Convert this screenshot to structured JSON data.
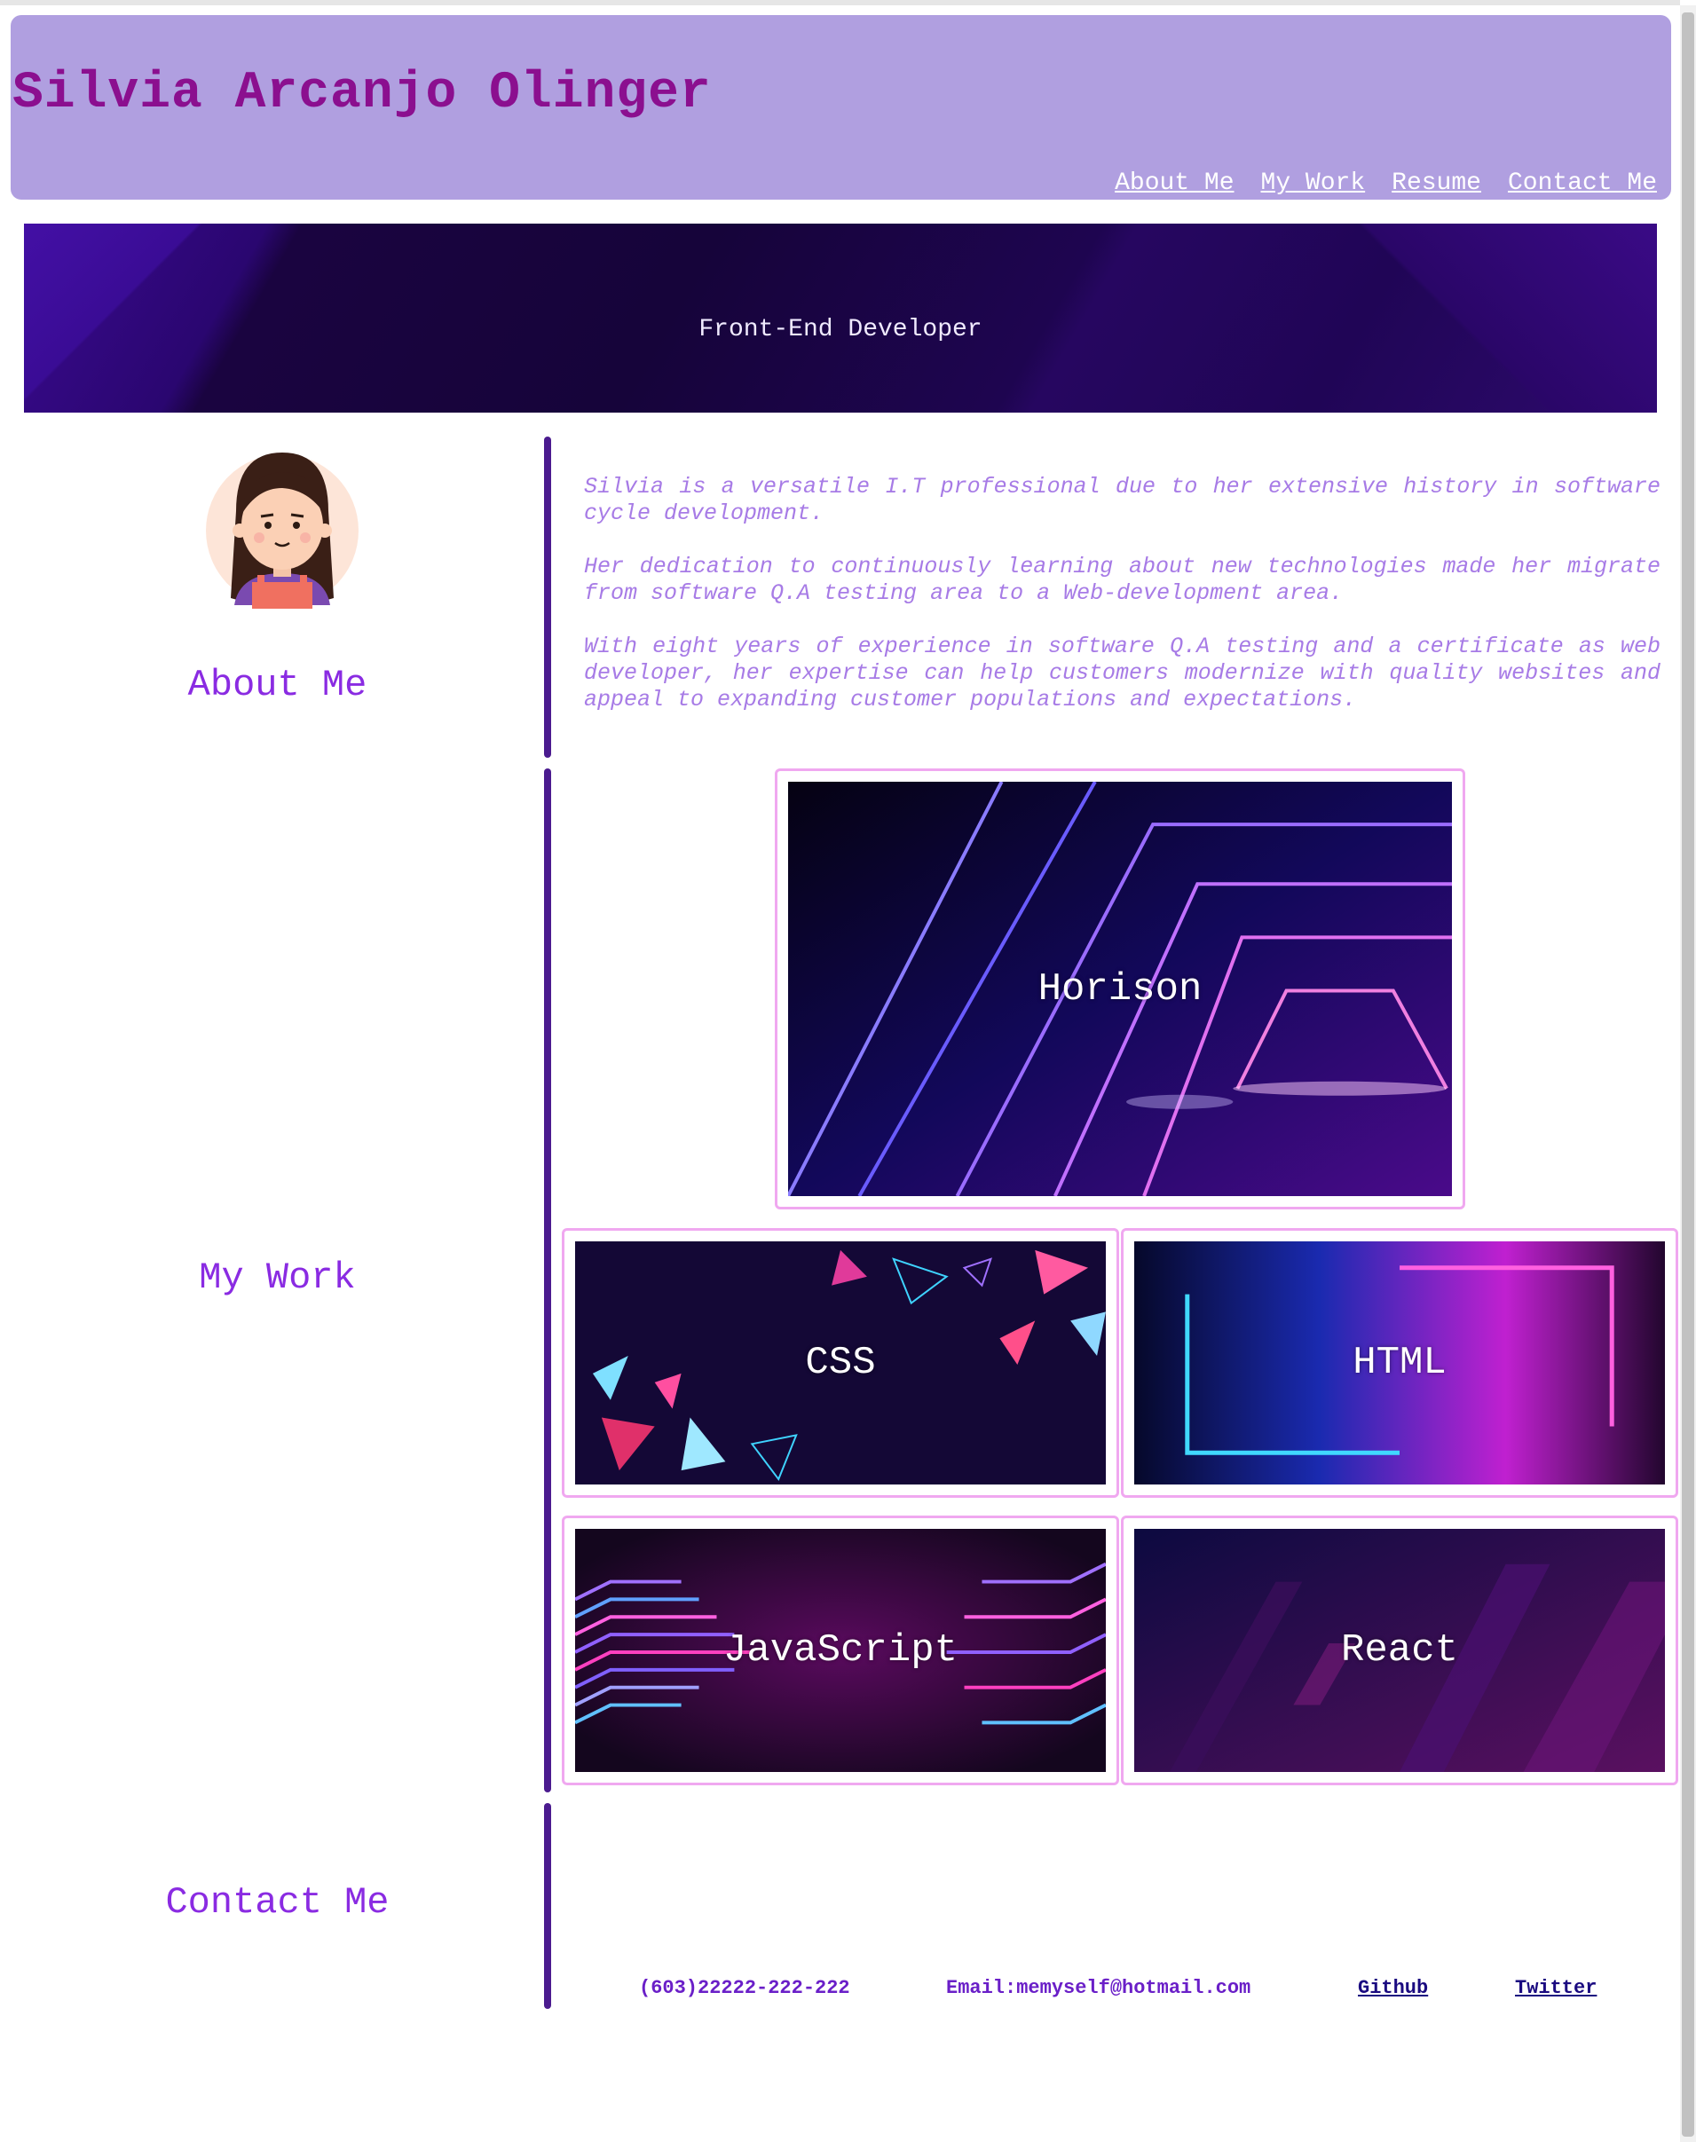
{
  "header": {
    "title": "Silvia Arcanjo Olinger",
    "nav": [
      "About Me",
      "My Work",
      "Resume",
      "Contact Me"
    ]
  },
  "hero": {
    "subtitle": "Front-End Developer"
  },
  "sections": {
    "about": "About Me",
    "work": "My Work",
    "contact": "Contact Me"
  },
  "about": {
    "paragraphs": [
      "Silvia is a versatile I.T professional due to her extensive history in software cycle development.",
      "Her dedication to continuously learning about new technologies made her migrate from software Q.A testing area to a Web-development area.",
      "With eight years of experience in software Q.A testing and a certificate as web developer, her expertise can help customers modernize with quality websites and appeal to expanding customer populations and expectations."
    ]
  },
  "projects": [
    {
      "title": "Horison"
    },
    {
      "title": "CSS"
    },
    {
      "title": "HTML"
    },
    {
      "title": "JavaScript"
    },
    {
      "title": "React"
    }
  ],
  "contact": {
    "phone": "(603)22222-222-222",
    "email": "Email:memyself@hotmail.com",
    "github": "Github",
    "twitter": "Twitter"
  },
  "colors": {
    "header_bg": "#b09fe0",
    "title": "#8b0f8f",
    "accent": "#8a2be2",
    "bar": "#4b1b8f",
    "card_border": "#f0a8f0"
  }
}
